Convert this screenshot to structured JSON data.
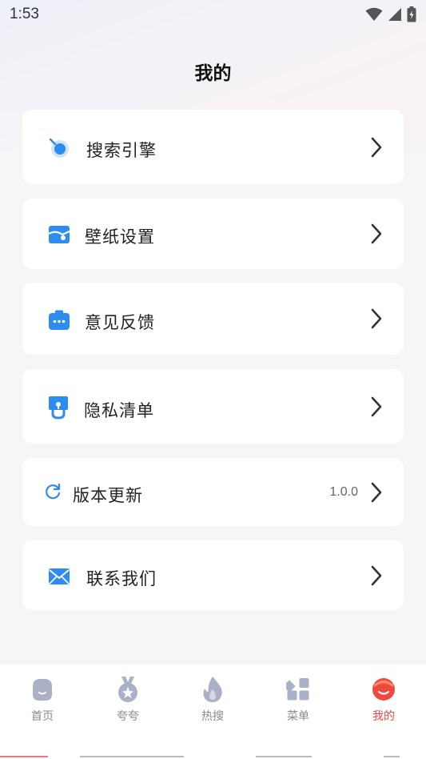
{
  "status": {
    "time": "1:53"
  },
  "page": {
    "title": "我的"
  },
  "menu": {
    "items": [
      {
        "key": "search-engine",
        "label": "搜索引擎",
        "icon": "search-engine-icon"
      },
      {
        "key": "wallpaper",
        "label": "壁纸设置",
        "icon": "wallpaper-icon"
      },
      {
        "key": "feedback",
        "label": "意见反馈",
        "icon": "feedback-icon"
      },
      {
        "key": "privacy",
        "label": "隐私清单",
        "icon": "privacy-icon"
      },
      {
        "key": "version",
        "label": "版本更新",
        "icon": "refresh-icon",
        "value": "1.0.0"
      },
      {
        "key": "contact",
        "label": "联系我们",
        "icon": "mail-icon"
      }
    ]
  },
  "tabs": [
    {
      "label": "首页",
      "icon": "home-icon"
    },
    {
      "label": "夸夸",
      "icon": "medal-icon"
    },
    {
      "label": "热搜",
      "icon": "flame-icon"
    },
    {
      "label": "菜单",
      "icon": "grid-menu-icon"
    },
    {
      "label": "我的",
      "icon": "profile-icon",
      "active": true
    }
  ],
  "colors": {
    "accent_blue": "#2d8cf0",
    "active_red": "#f0483e",
    "inactive_tab": "#aab0c6"
  }
}
